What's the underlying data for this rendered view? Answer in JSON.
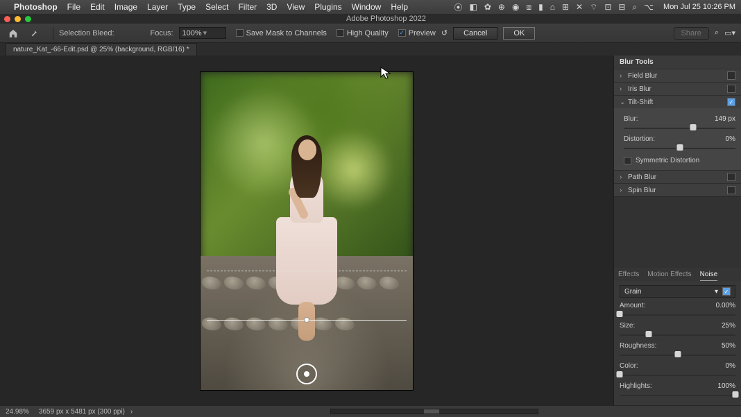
{
  "menubar": {
    "app": "Photoshop",
    "items": [
      "File",
      "Edit",
      "Image",
      "Layer",
      "Type",
      "Select",
      "Filter",
      "3D",
      "View",
      "Plugins",
      "Window",
      "Help"
    ],
    "clock": "Mon Jul 25  10:26 PM"
  },
  "window": {
    "title": "Adobe Photoshop 2022"
  },
  "options": {
    "selection_bleed_label": "Selection Bleed:",
    "focus_label": "Focus:",
    "focus_value": "100%",
    "save_mask_label": "Save Mask to Channels",
    "high_quality_label": "High Quality",
    "preview_label": "Preview",
    "cancel": "Cancel",
    "ok": "OK",
    "share": "Share"
  },
  "doc_tab": "nature_Kat_-66-Edit.psd @ 25% (background, RGB/16) *",
  "blur_panel": {
    "title": "Blur Tools",
    "items": [
      {
        "label": "Field Blur",
        "checked": false
      },
      {
        "label": "Iris Blur",
        "checked": false
      },
      {
        "label": "Tilt-Shift",
        "checked": true,
        "expanded": true
      },
      {
        "label": "Path Blur",
        "checked": false
      },
      {
        "label": "Spin Blur",
        "checked": false
      }
    ],
    "tilt": {
      "blur_label": "Blur:",
      "blur_value": "149 px",
      "blur_pct": 62,
      "distortion_label": "Distortion:",
      "distortion_value": "0%",
      "distortion_pct": 50,
      "sym_label": "Symmetric Distortion"
    }
  },
  "effects_tabs": {
    "effects": "Effects",
    "motion": "Motion Effects",
    "noise": "Noise"
  },
  "noise": {
    "grain_label": "Grain",
    "amount_label": "Amount:",
    "amount_value": "0.00%",
    "amount_pct": 0,
    "size_label": "Size:",
    "size_value": "25%",
    "size_pct": 25,
    "rough_label": "Roughness:",
    "rough_value": "50%",
    "rough_pct": 50,
    "color_label": "Color:",
    "color_value": "0%",
    "color_pct": 0,
    "highlights_label": "Highlights:",
    "highlights_value": "100%",
    "highlights_pct": 100
  },
  "status": {
    "zoom": "24.98%",
    "dims": "3659 px x 5481 px (300 ppi)"
  }
}
